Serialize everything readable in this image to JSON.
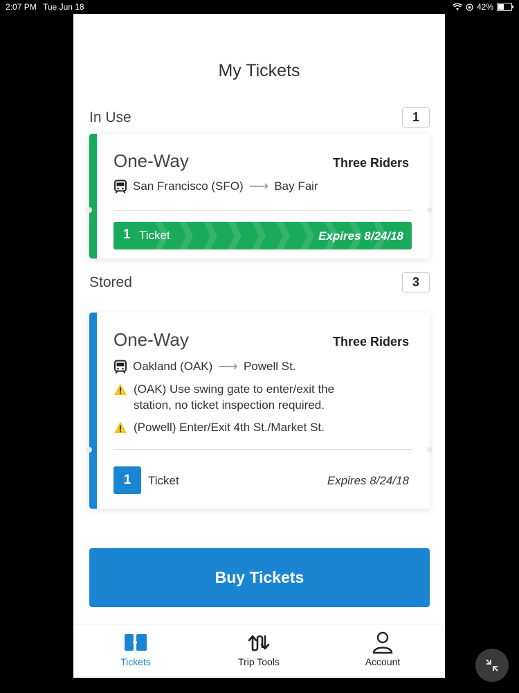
{
  "status_bar": {
    "time": "2:07 PM",
    "date": "Tue Jun 18",
    "battery": "42%"
  },
  "page": {
    "title": "My Tickets"
  },
  "in_use": {
    "label": "In Use",
    "count": "1",
    "card": {
      "type": "One-Way",
      "riders": "Three Riders",
      "origin": "San Francisco (SFO)",
      "destination": "Bay Fair",
      "ticket_count": "1",
      "ticket_label": "Ticket",
      "expires": "Expires 8/24/18",
      "accent_color": "#1aaa5b"
    }
  },
  "stored": {
    "label": "Stored",
    "count": "3",
    "card": {
      "type": "One-Way",
      "riders": "Three Riders",
      "origin": "Oakland (OAK)",
      "destination": "Powell St.",
      "notices": [
        {
          "line1": "(OAK) Use swing gate to enter/exit the",
          "line2": "station, no ticket inspection required."
        },
        {
          "line1": "(Powell) Enter/Exit 4th St./Market St."
        }
      ],
      "ticket_count": "1",
      "ticket_label": "Ticket",
      "expires": "Expires 8/24/18",
      "accent_color": "#1a86d3"
    }
  },
  "buy_button": {
    "label": "Buy Tickets"
  },
  "tabs": [
    {
      "label": "Tickets",
      "icon": "tickets-icon",
      "active": true
    },
    {
      "label": "Trip Tools",
      "icon": "trip-tools-icon",
      "active": false
    },
    {
      "label": "Account",
      "icon": "account-icon",
      "active": false
    }
  ]
}
